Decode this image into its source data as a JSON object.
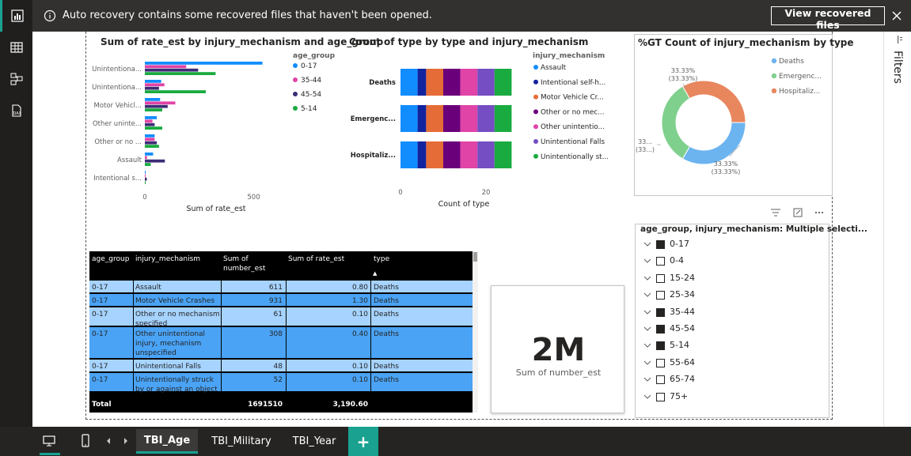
{
  "notification": {
    "message": "Auto recovery contains some recovered files that haven't been opened.",
    "button_label": "View recovered files"
  },
  "filter_pane": {
    "label": "Filters"
  },
  "tabs": [
    {
      "label": "TBI_Age",
      "active": true
    },
    {
      "label": "TBI_Military",
      "active": false
    },
    {
      "label": "TBI_Year",
      "active": false
    }
  ],
  "add_tab_label": "+",
  "colors": {
    "accent": "#1aa190",
    "series_0_17": "#118dff",
    "series_35_44": "#e044a7",
    "series_45_54": "#3d2d76",
    "series_5_14": "#1aab40",
    "assault": "#118dff",
    "intentional_self": "#12239e",
    "motor_vehicle": "#e66c37",
    "other_no_mech": "#6b007b",
    "other_unintentional": "#e044a7",
    "unintentional_falls": "#744ec2",
    "unintentionally_struck": "#1aab40",
    "deaths": "#6cb4f0",
    "emergency": "#7fd08d",
    "hospitalized": "#e8865e",
    "table_light": "#a6d3ff",
    "table_mid": "#4aa3f5"
  },
  "chart_data": [
    {
      "type": "bar",
      "orientation": "horizontal",
      "title": "Sum of rate_est by injury_mechanism and age_group",
      "xlabel": "Sum of rate_est",
      "ylabel": "",
      "legend_title": "age_group",
      "legend_position": "right",
      "xlim": [
        0,
        700
      ],
      "x_ticks": [
        "0",
        "500"
      ],
      "categories": [
        "Unintentiona...",
        "Unintentiona...",
        "Motor Vehicl...",
        "Other uninte...",
        "Other or no ...",
        "Assault",
        "Intentional s..."
      ],
      "series": [
        {
          "name": "0-17",
          "values": [
            540,
            75,
            70,
            55,
            45,
            38,
            3
          ]
        },
        {
          "name": "35-44",
          "values": [
            190,
            90,
            140,
            35,
            45,
            10,
            4
          ]
        },
        {
          "name": "45-54",
          "values": [
            245,
            65,
            105,
            45,
            55,
            92,
            9
          ]
        },
        {
          "name": "5-14",
          "values": [
            325,
            280,
            80,
            80,
            65,
            27,
            3
          ]
        }
      ]
    },
    {
      "type": "bar",
      "orientation": "horizontal",
      "stacked": true,
      "title": "Count of type by type and injury_mechanism",
      "xlabel": "Count of type",
      "ylabel": "",
      "legend_title": "injury_mechanism",
      "legend_position": "right",
      "xlim": [
        0,
        25
      ],
      "x_ticks": [
        "0",
        "20"
      ],
      "categories": [
        "Deaths",
        "Emergenc...",
        "Hospitaliz..."
      ],
      "series": [
        {
          "name": "Assault",
          "values": [
            4,
            4,
            4
          ]
        },
        {
          "name": "Intentional self-h...",
          "values": [
            2,
            2,
            2
          ]
        },
        {
          "name": "Motor Vehicle Cr...",
          "values": [
            4,
            4,
            4
          ]
        },
        {
          "name": "Other or no mec...",
          "values": [
            4,
            4,
            4
          ]
        },
        {
          "name": "Other unintentio...",
          "values": [
            4,
            4,
            4
          ]
        },
        {
          "name": "Unintentional Falls",
          "values": [
            4,
            4,
            4
          ]
        },
        {
          "name": "Unintentionally st...",
          "values": [
            4,
            4,
            4
          ]
        }
      ]
    },
    {
      "type": "pie",
      "donut": true,
      "title": "%GT Count of injury_mechanism by type",
      "legend_position": "right",
      "categories": [
        "Deaths",
        "Emergenc...",
        "Hospitaliz..."
      ],
      "values": [
        33.33,
        33.33,
        33.33
      ],
      "labels": [
        {
          "line1": "33.33%",
          "line2": "(33.33%)"
        },
        {
          "line1": "33...",
          "line2": "(33...)"
        },
        {
          "line1": "33.33%",
          "line2": "(33.33%)"
        }
      ]
    }
  ],
  "table": {
    "headers": [
      "age_group",
      "injury_mechanism",
      "Sum of number_est",
      "Sum of rate_est",
      "type"
    ],
    "sort_indicator": "▲",
    "rows": [
      {
        "age": "0-17",
        "mech": "Assault",
        "num": "611",
        "rate": "0.80",
        "type": "Deaths"
      },
      {
        "age": "0-17",
        "mech": "Motor Vehicle Crashes",
        "num": "931",
        "rate": "1.30",
        "type": "Deaths"
      },
      {
        "age": "0-17",
        "mech": "Other or no mechanism specified",
        "num": "61",
        "rate": "0.10",
        "type": "Deaths"
      },
      {
        "age": "0-17",
        "mech": "Other unintentional injury, mechanism unspecified",
        "num": "308",
        "rate": "0.40",
        "type": "Deaths"
      },
      {
        "age": "0-17",
        "mech": "Unintentional Falls",
        "num": "48",
        "rate": "0.10",
        "type": "Deaths"
      },
      {
        "age": "0-17",
        "mech": "Unintentionally struck by or against an object",
        "num": "52",
        "rate": "0.10",
        "type": "Deaths"
      }
    ],
    "total": {
      "label": "Total",
      "num": "1691510",
      "rate": "3,190.60"
    }
  },
  "card": {
    "value": "2M",
    "caption": "Sum of number_est"
  },
  "slicer": {
    "title": "age_group, injury_mechanism: Multiple selecti...",
    "items": [
      {
        "label": "0-17",
        "checked": true
      },
      {
        "label": "0-4",
        "checked": false
      },
      {
        "label": "15-24",
        "checked": false
      },
      {
        "label": "25-34",
        "checked": false
      },
      {
        "label": "35-44",
        "checked": true
      },
      {
        "label": "45-54",
        "checked": true
      },
      {
        "label": "5-14",
        "checked": true
      },
      {
        "label": "55-64",
        "checked": false
      },
      {
        "label": "65-74",
        "checked": false
      },
      {
        "label": "75+",
        "checked": false
      }
    ]
  },
  "icons": {
    "nav": [
      "report-icon",
      "data-table-icon",
      "model-icon",
      "dax-icon"
    ],
    "bottom": [
      "desktop-layout-icon",
      "mobile-layout-icon",
      "prev-page-icon",
      "next-page-icon"
    ]
  }
}
